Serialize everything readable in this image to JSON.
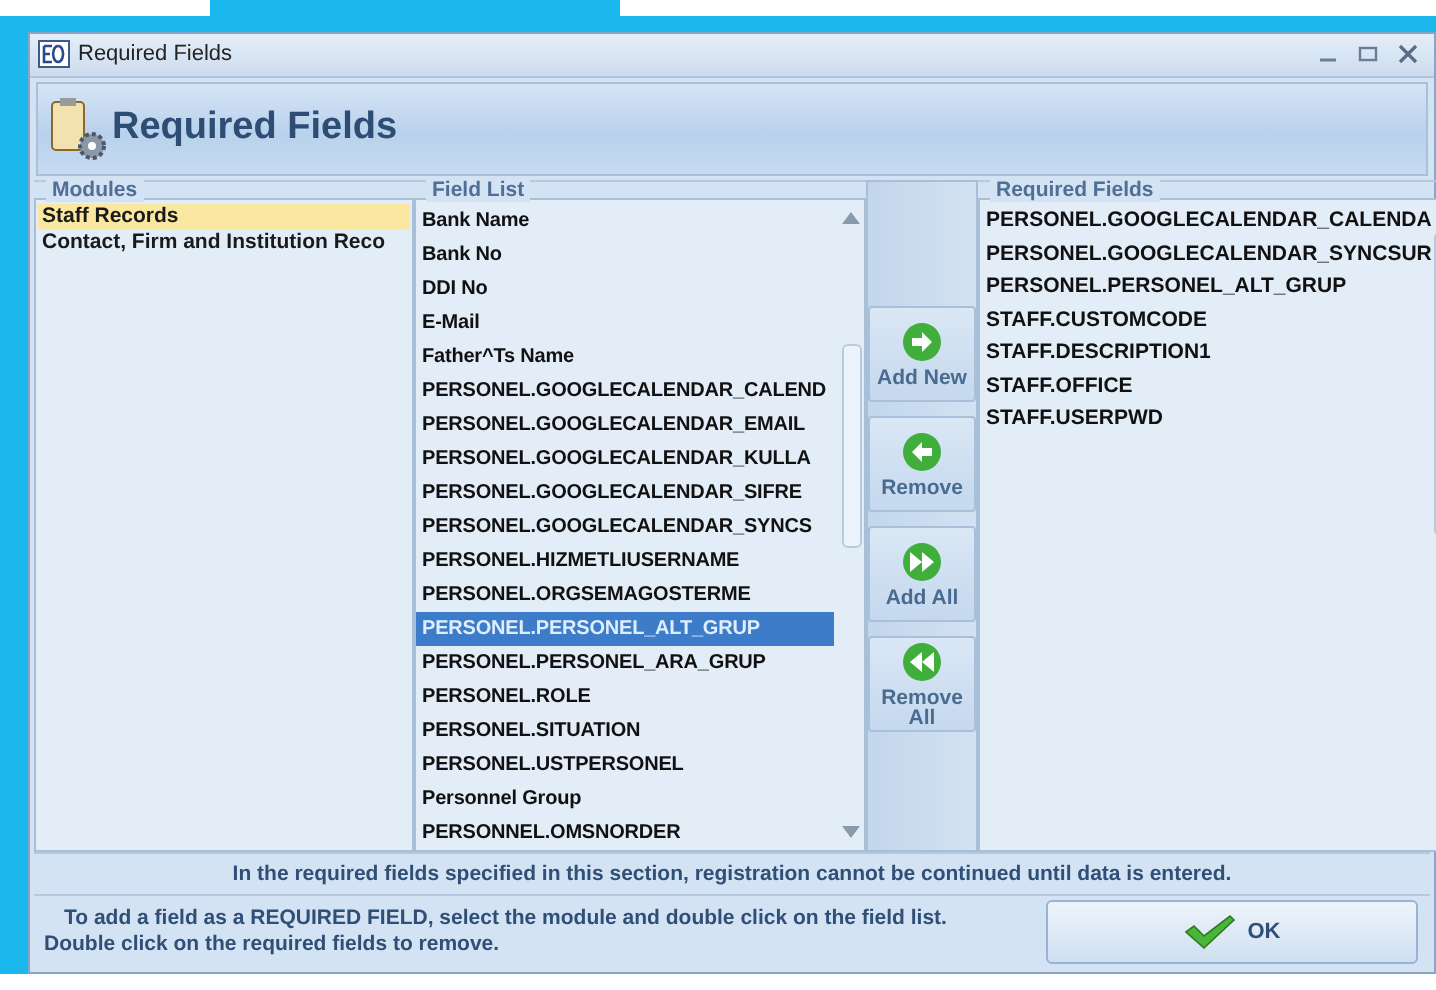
{
  "window": {
    "title": "Required Fields"
  },
  "header": {
    "title": "Required Fields"
  },
  "modules": {
    "legend": "Modules",
    "items": [
      {
        "label": "Staff Records",
        "selected": true
      },
      {
        "label": "Contact, Firm and Institution Reco",
        "selected": false
      }
    ]
  },
  "field_list": {
    "legend": "Field List",
    "items": [
      {
        "label": "Bank Name",
        "selected": false
      },
      {
        "label": "Bank No",
        "selected": false
      },
      {
        "label": "DDI No",
        "selected": false
      },
      {
        "label": "E-Mail",
        "selected": false
      },
      {
        "label": "Father^Ts Name",
        "selected": false
      },
      {
        "label": "PERSONEL.GOOGLECALENDAR_CALEND",
        "selected": false
      },
      {
        "label": "PERSONEL.GOOGLECALENDAR_EMAIL",
        "selected": false
      },
      {
        "label": "PERSONEL.GOOGLECALENDAR_KULLA",
        "selected": false
      },
      {
        "label": "PERSONEL.GOOGLECALENDAR_SIFRE",
        "selected": false
      },
      {
        "label": "PERSONEL.GOOGLECALENDAR_SYNCS",
        "selected": false
      },
      {
        "label": "PERSONEL.HIZMETLIUSERNAME",
        "selected": false
      },
      {
        "label": "PERSONEL.ORGSEMAGOSTERME",
        "selected": false
      },
      {
        "label": "PERSONEL.PERSONEL_ALT_GRUP",
        "selected": true
      },
      {
        "label": "PERSONEL.PERSONEL_ARA_GRUP",
        "selected": false
      },
      {
        "label": "PERSONEL.ROLE",
        "selected": false
      },
      {
        "label": "PERSONEL.SITUATION",
        "selected": false
      },
      {
        "label": "PERSONEL.USTPERSONEL",
        "selected": false
      },
      {
        "label": "Personnel Group",
        "selected": false
      },
      {
        "label": "PERSONNEL.OMSNORDER",
        "selected": false
      }
    ]
  },
  "actions": [
    {
      "label": "Add New",
      "kind": "right"
    },
    {
      "label": "Remove",
      "kind": "left"
    },
    {
      "label": "Add All",
      "kind": "all-right"
    },
    {
      "label": "Remove All",
      "kind": "all-left"
    }
  ],
  "required_fields": {
    "legend": "Required Fields",
    "items": [
      "PERSONEL.GOOGLECALENDAR_CALENDA",
      "PERSONEL.GOOGLECALENDAR_SYNCSUR",
      "PERSONEL.PERSONEL_ALT_GRUP",
      "STAFF.CUSTOMCODE",
      "STAFF.DESCRIPTION1",
      "STAFF.OFFICE",
      "STAFF.USERPWD"
    ]
  },
  "info": "In the required fields specified in this section, registration cannot be continued until data is entered.",
  "hint": "To add a field as a REQUIRED FIELD, select the module and double click on the field list. Double click on the required fields to remove.",
  "ok_button": "OK"
}
